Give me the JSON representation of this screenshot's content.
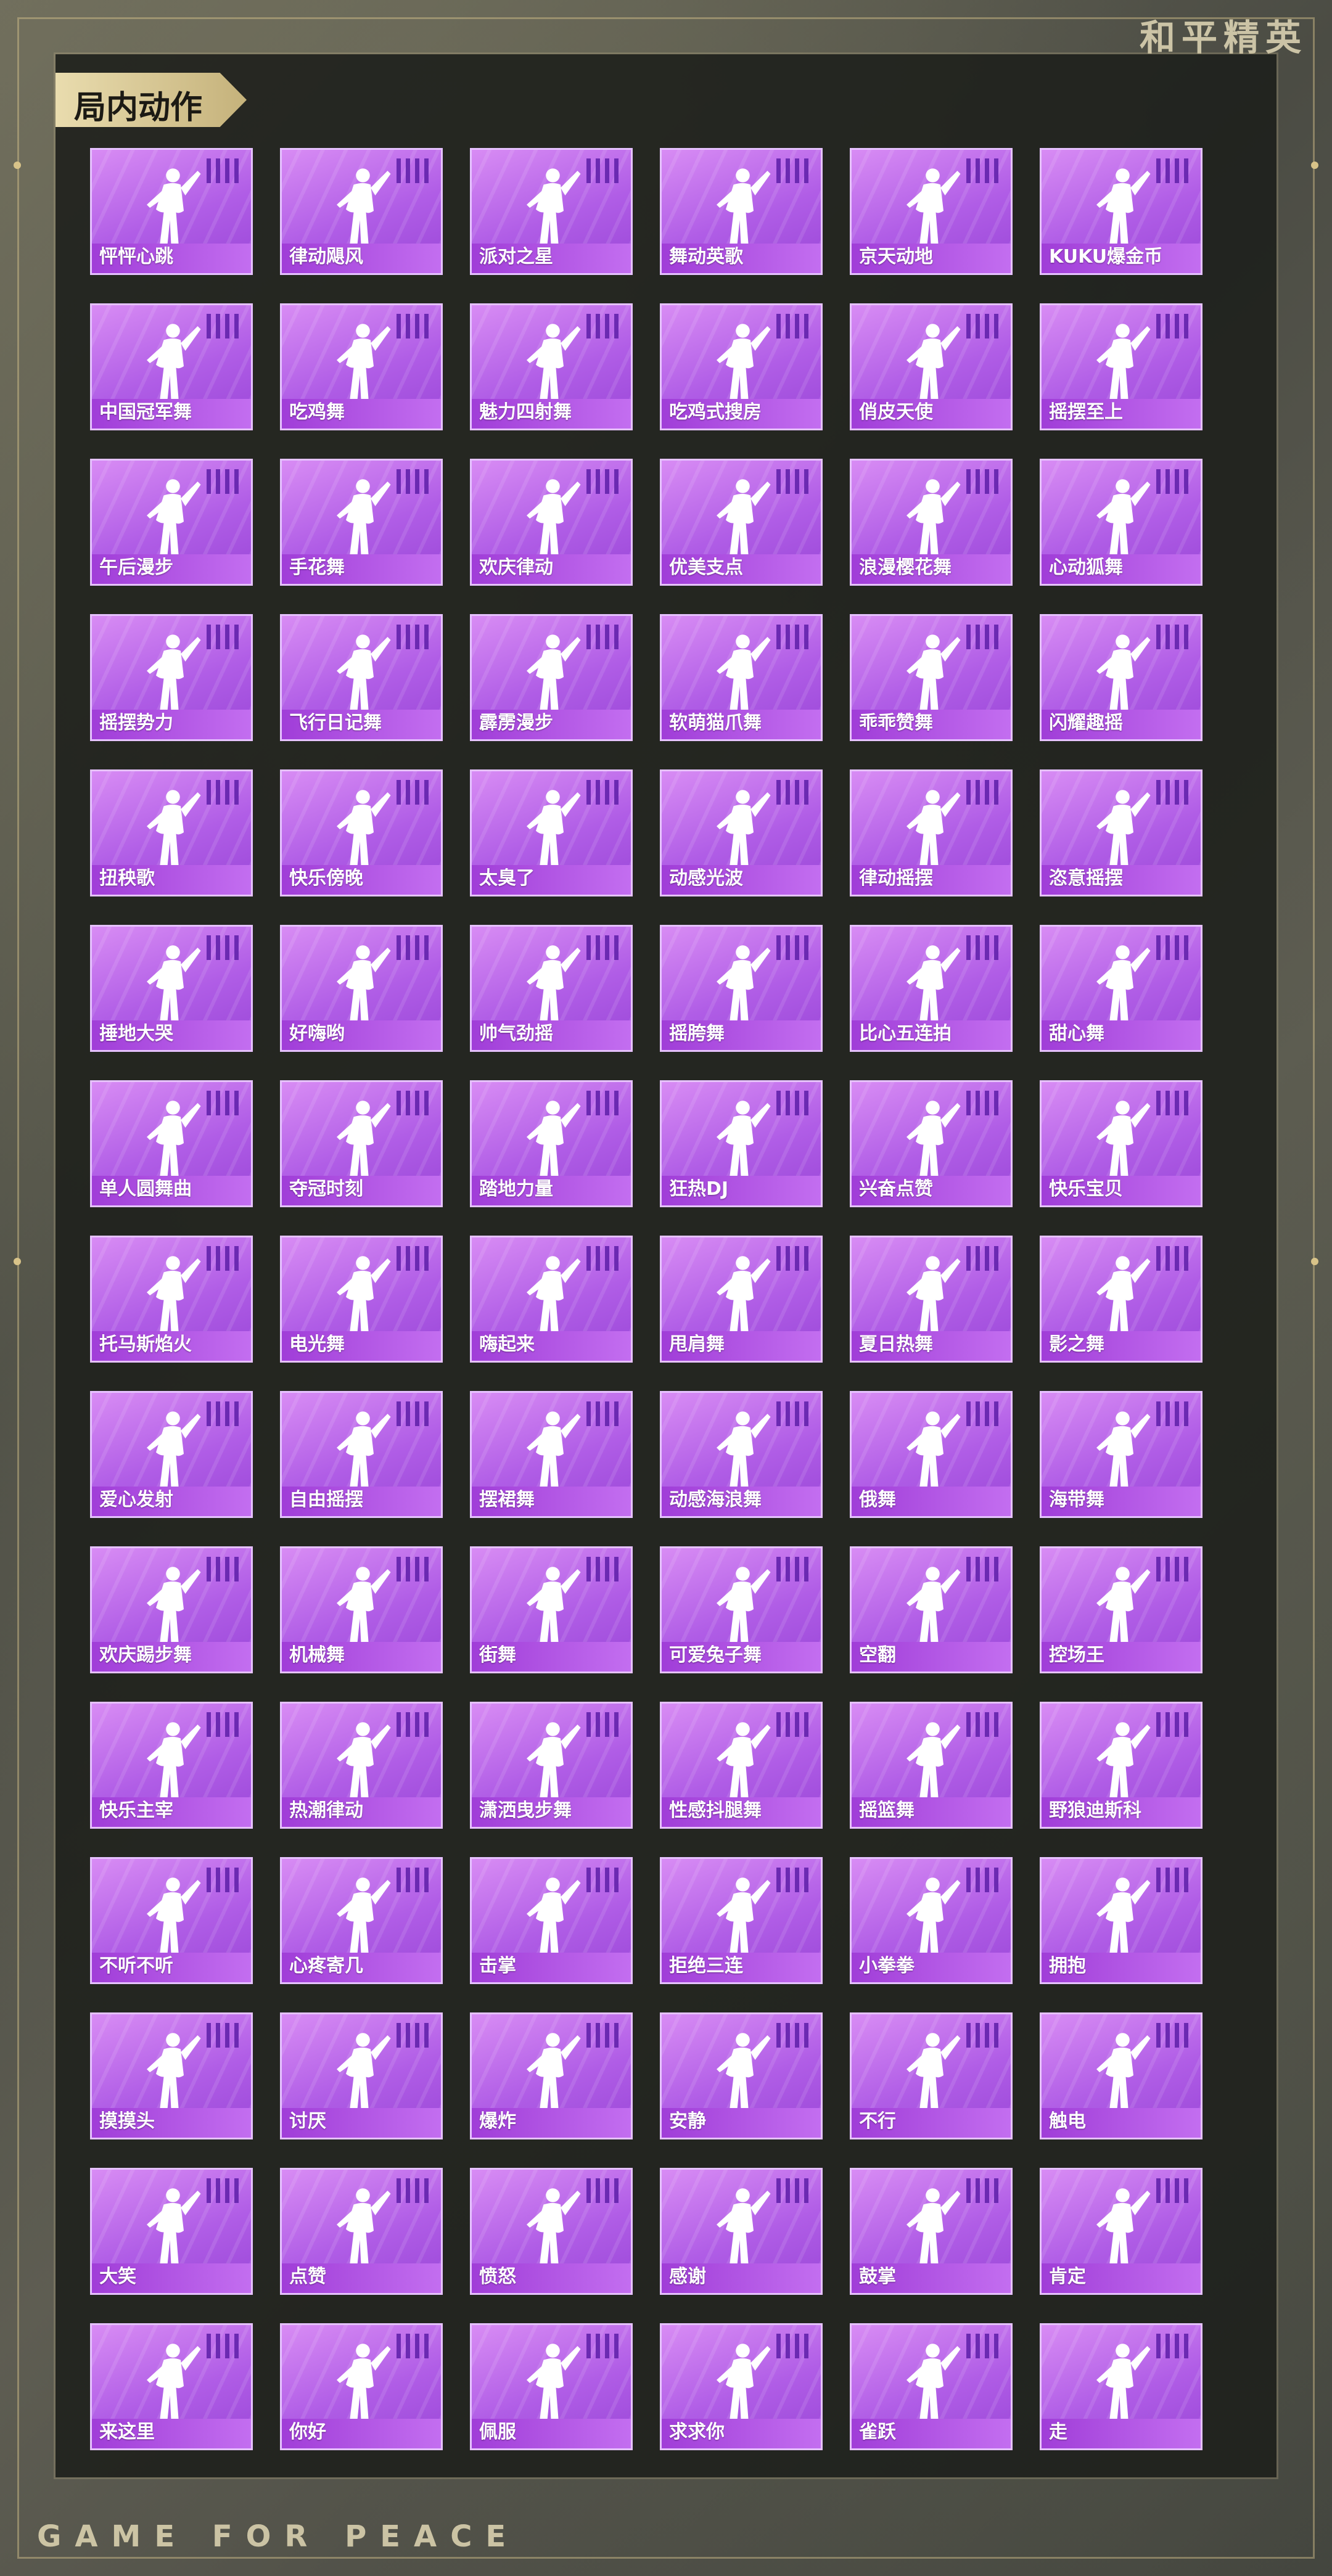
{
  "brand": "和平精英",
  "section_title": "局内动作",
  "footer": "GAME FOR PEACE",
  "colors": {
    "card": "#b05de6",
    "accent": "#e9dcae"
  },
  "items": [
    "怦怦心跳",
    "律动飓风",
    "派对之星",
    "舞动英歌",
    "京天动地",
    "KUKU爆金币",
    "中国冠军舞",
    "吃鸡舞",
    "魅力四射舞",
    "吃鸡式搜房",
    "俏皮天使",
    "摇摆至上",
    "午后漫步",
    "手花舞",
    "欢庆律动",
    "优美支点",
    "浪漫樱花舞",
    "心动狐舞",
    "摇摆势力",
    "飞行日记舞",
    "霹雳漫步",
    "软萌猫爪舞",
    "乖乖赞舞",
    "闪耀趣摇",
    "扭秧歌",
    "快乐傍晚",
    "太臭了",
    "动感光波",
    "律动摇摆",
    "恣意摇摆",
    "捶地大哭",
    "好嗨哟",
    "帅气劲摇",
    "摇胯舞",
    "比心五连拍",
    "甜心舞",
    "单人圆舞曲",
    "夺冠时刻",
    "踏地力量",
    "狂热DJ",
    "兴奋点赞",
    "快乐宝贝",
    "托马斯焰火",
    "电光舞",
    "嗨起来",
    "甩肩舞",
    "夏日热舞",
    "影之舞",
    "爱心发射",
    "自由摇摆",
    "摆裙舞",
    "动感海浪舞",
    "俄舞",
    "海带舞",
    "欢庆踢步舞",
    "机械舞",
    "街舞",
    "可爱兔子舞",
    "空翻",
    "控场王",
    "快乐主宰",
    "热潮律动",
    "潇洒曳步舞",
    "性感抖腿舞",
    "摇篮舞",
    "野狼迪斯科",
    "不听不听",
    "心疼寄几",
    "击掌",
    "拒绝三连",
    "小拳拳",
    "拥抱",
    "摸摸头",
    "讨厌",
    "爆炸",
    "安静",
    "不行",
    "触电",
    "大笑",
    "点赞",
    "愤怒",
    "感谢",
    "鼓掌",
    "肯定",
    "来这里",
    "你好",
    "佩服",
    "求求你",
    "雀跃",
    "走"
  ]
}
